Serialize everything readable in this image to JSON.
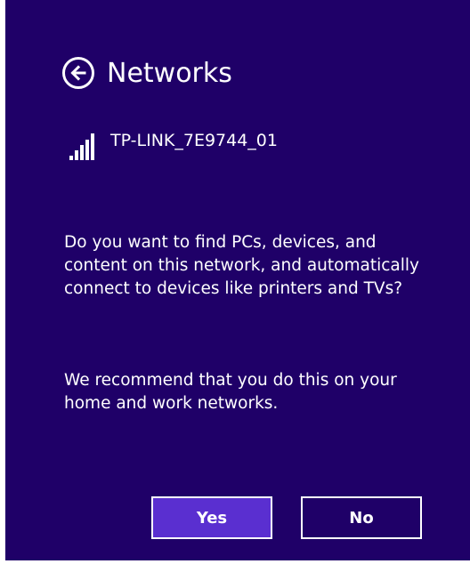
{
  "header": {
    "title": "Networks",
    "back_icon": "back-arrow-icon"
  },
  "network": {
    "name": "TP-LINK_7E9744_01",
    "signal_icon": "wifi-signal-icon"
  },
  "prompt": {
    "question": "Do you want to find PCs, devices, and content on this network, and automatically connect to devices like printers and TVs?",
    "recommendation": "We recommend that you do this on your home and work networks."
  },
  "buttons": {
    "yes_label": "Yes",
    "no_label": "No"
  },
  "colors": {
    "background": "#1f0068",
    "accent": "#5a2fd0",
    "text": "#ffffff"
  }
}
